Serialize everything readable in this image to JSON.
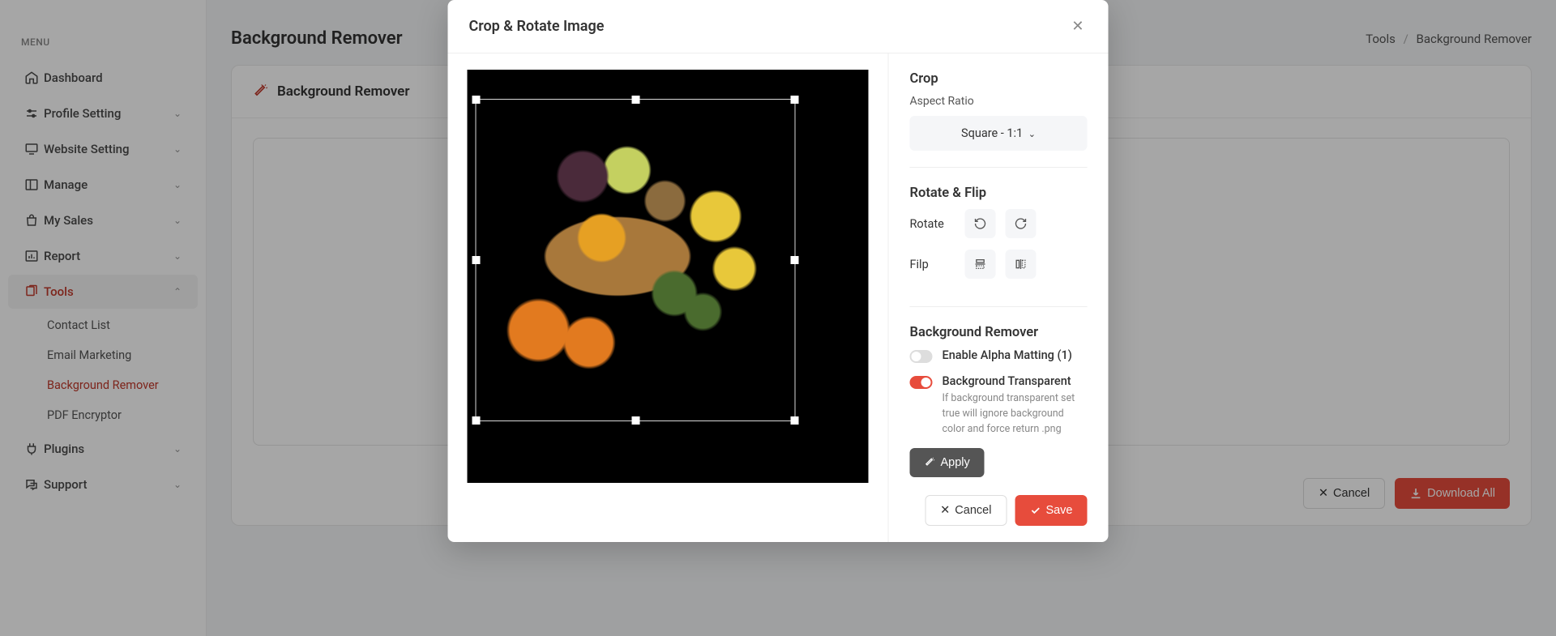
{
  "sidebar": {
    "menu_label": "MENU",
    "items": [
      {
        "icon": "home",
        "label": "Dashboard",
        "expandable": false
      },
      {
        "icon": "sliders",
        "label": "Profile Setting",
        "expandable": true
      },
      {
        "icon": "monitor",
        "label": "Website Setting",
        "expandable": true
      },
      {
        "icon": "layout",
        "label": "Manage",
        "expandable": true
      },
      {
        "icon": "bag",
        "label": "My Sales",
        "expandable": true
      },
      {
        "icon": "chart",
        "label": "Report",
        "expandable": true
      },
      {
        "icon": "copy",
        "label": "Tools",
        "expandable": true,
        "active": true
      },
      {
        "icon": "plug",
        "label": "Plugins",
        "expandable": true
      },
      {
        "icon": "chat",
        "label": "Support",
        "expandable": true
      }
    ],
    "tools_sub": [
      {
        "label": "Contact List"
      },
      {
        "label": "Email Marketing"
      },
      {
        "label": "Background Remover",
        "active": true
      },
      {
        "label": "PDF Encryptor"
      }
    ]
  },
  "page": {
    "title": "Background Remover",
    "breadcrumb_parent": "Tools",
    "breadcrumb_current": "Background Remover",
    "card_title": "Background Remover",
    "cancel_btn": "Cancel",
    "download_btn": "Download All"
  },
  "modal": {
    "title": "Crop & Rotate Image",
    "crop": {
      "heading": "Crop",
      "aspect_label": "Aspect Ratio",
      "aspect_value": "Square - 1:1"
    },
    "rotate": {
      "heading": "Rotate & Flip",
      "rotate_label": "Rotate",
      "flip_label": "Filp"
    },
    "bg": {
      "heading": "Background Remover",
      "alpha_label": "Enable Alpha Matting (1)",
      "transparent_label": "Background Transparent",
      "transparent_desc": "If background transparent set true will ignore background color and force return .png",
      "apply_btn": "Apply"
    },
    "cancel_btn": "Cancel",
    "save_btn": "Save"
  }
}
